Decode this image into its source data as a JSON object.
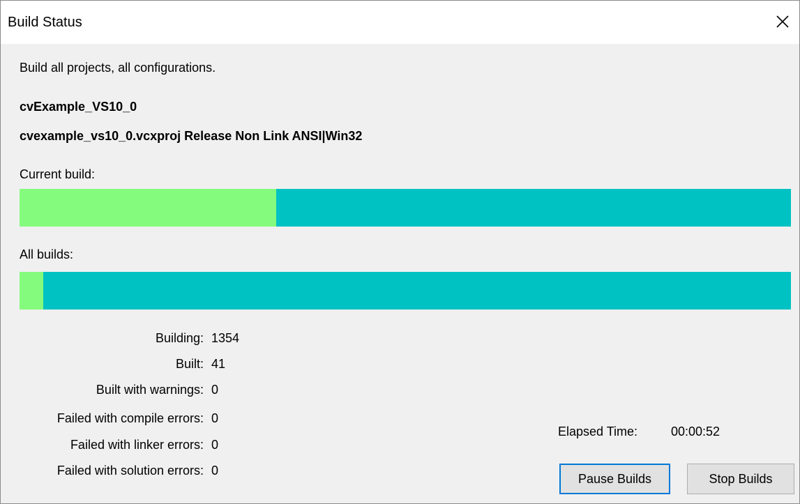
{
  "window": {
    "title": "Build Status"
  },
  "info": {
    "description": "Build all projects, all configurations.",
    "project_name": "cvExample_VS10_0",
    "project_config": "cvexample_vs10_0.vcxproj Release Non Link ANSI|Win32"
  },
  "progress": {
    "current_label": "Current build:",
    "current_fraction": 0.333,
    "all_label": "All builds:",
    "all_fraction": 0.031,
    "fill_color": "#85fb7d",
    "track_color": "#00c2c2"
  },
  "stats": [
    {
      "label": "Building:",
      "value": "1354"
    },
    {
      "label": "Built:",
      "value": "41"
    },
    {
      "label": "Built with warnings:",
      "value": "0"
    },
    {
      "label": "Failed with compile errors:",
      "value": "0"
    },
    {
      "label": "Failed with linker errors:",
      "value": "0"
    },
    {
      "label": "Failed with solution errors:",
      "value": "0"
    }
  ],
  "elapsed": {
    "label": "Elapsed Time:",
    "value": "00:00:52"
  },
  "buttons": {
    "pause_label": "Pause Builds",
    "stop_label": "Stop Builds"
  },
  "icons": {
    "close": "close-icon"
  },
  "colors": {
    "default_button_border": "#0078d7"
  }
}
